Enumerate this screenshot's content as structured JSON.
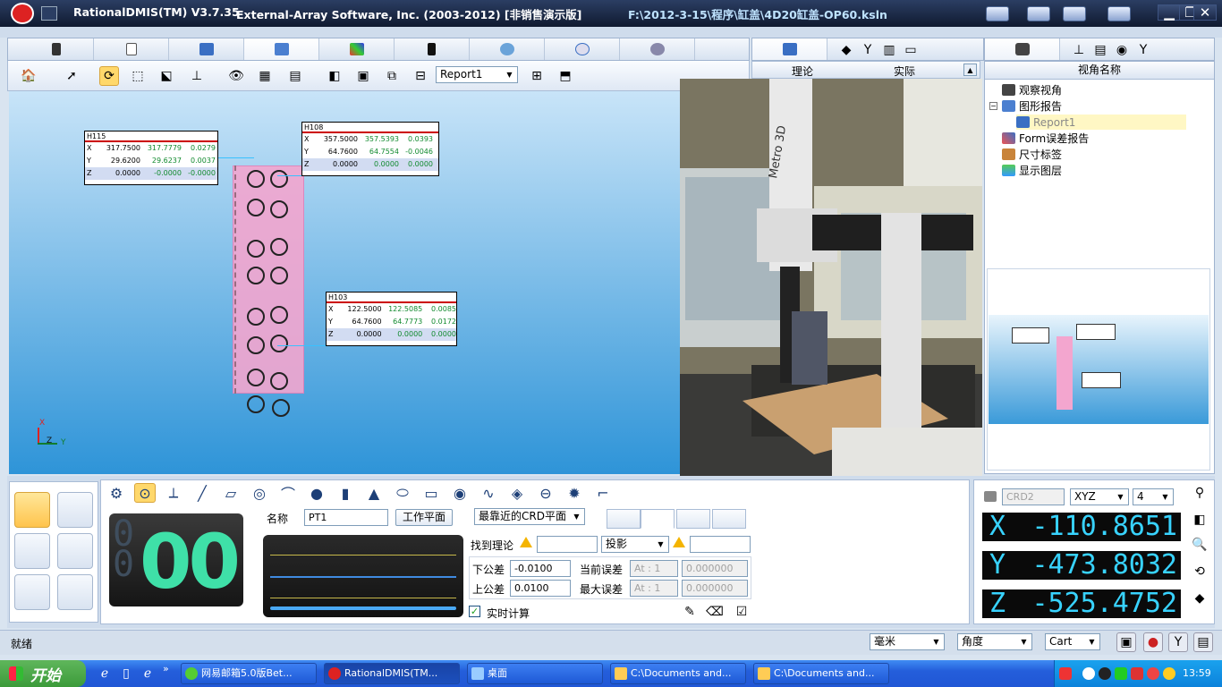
{
  "titlebar": {
    "app": "RationalDMIS(TM) V3.7.35",
    "company": "External-Array Software, Inc. (2003-2012) [非销售演示版]",
    "file": "F:\\2012-3-15\\程序\\缸盖\\4D20缸盖-OP60.ksln",
    "minimize": "▁",
    "restore": "❐",
    "close": "✕"
  },
  "toolbar": {
    "report_select": "Report1"
  },
  "compare_header": {
    "nominal": "理论",
    "actual": "实际"
  },
  "dims": [
    {
      "name": "H115",
      "rows": [
        {
          "axis": "X",
          "nominal": "317.7500",
          "actual": "317.7779",
          "dev": "0.0279"
        },
        {
          "axis": "Y",
          "nominal": "29.6200",
          "actual": "29.6237",
          "dev": "0.0037"
        },
        {
          "axis": "Z",
          "nominal": "0.0000",
          "actual": "-0.0000",
          "dev": "-0.0000"
        }
      ]
    },
    {
      "name": "H108",
      "rows": [
        {
          "axis": "X",
          "nominal": "357.5000",
          "actual": "357.5393",
          "dev": "0.0393"
        },
        {
          "axis": "Y",
          "nominal": "64.7600",
          "actual": "64.7554",
          "dev": "-0.0046"
        },
        {
          "axis": "Z",
          "nominal": "0.0000",
          "actual": "0.0000",
          "dev": "0.0000"
        }
      ]
    },
    {
      "name": "H103",
      "rows": [
        {
          "axis": "X",
          "nominal": "122.5000",
          "actual": "122.5085",
          "dev": "0.0085"
        },
        {
          "axis": "Y",
          "nominal": "64.7600",
          "actual": "64.7773",
          "dev": "0.0172"
        },
        {
          "axis": "Z",
          "nominal": "0.0000",
          "actual": "0.0000",
          "dev": "0.0000"
        }
      ]
    }
  ],
  "triad": {
    "x": "X",
    "y": "Y",
    "z": "Z"
  },
  "viewpanel": {
    "header": "视角名称",
    "items": [
      "观察视角",
      "图形报告",
      "Report1",
      "Form误差报告",
      "尺寸标签",
      "显示图层"
    ]
  },
  "feature": {
    "counter_small_1": "0",
    "counter_small_2": "0",
    "counter_big": "00",
    "name_label": "名称",
    "name_value": "PT1",
    "workplane_btn": "工作平面",
    "crd_select": "最靠近的CRD平面",
    "find_nominal_label": "找到理论",
    "projection_select": "投影",
    "lower_tol_label": "下公差",
    "lower_tol_value": "-0.0100",
    "upper_tol_label": "上公差",
    "upper_tol_value": "0.0100",
    "current_err_label": "当前误差",
    "current_err_at": "At : 1",
    "current_err_value": "0.000000",
    "max_err_label": "最大误差",
    "max_err_at": "At : 1",
    "max_err_value": "0.000000",
    "realtime_label": "实时计算"
  },
  "dro": {
    "crd": "CRD2",
    "plane": "XYZ",
    "decimals": "4",
    "x_axis": "X",
    "x_value": "-110.8651",
    "y_axis": "Y",
    "y_value": "-473.8032",
    "z_axis": "Z",
    "z_value": "-525.4752"
  },
  "statusbar": {
    "status": "就绪",
    "unit": "毫米",
    "angle": "角度",
    "coord": "Cart"
  },
  "taskbar": {
    "start": "开始",
    "tasks": [
      "网易邮箱5.0版Bet...",
      "RationalDMIS(TM...",
      "桌面",
      "C:\\Documents and...",
      "C:\\Documents and..."
    ],
    "clock": "13:59",
    "more": "»"
  },
  "colors": {
    "title_bg": "#17233f",
    "viewport_top": "#c8e4f8",
    "viewport_bottom": "#2e94d8",
    "part_pink": "#f3a6cf",
    "dro_text": "#38d3ff",
    "counter_green": "#3fe0a8",
    "dev_green": "#118a2e"
  }
}
